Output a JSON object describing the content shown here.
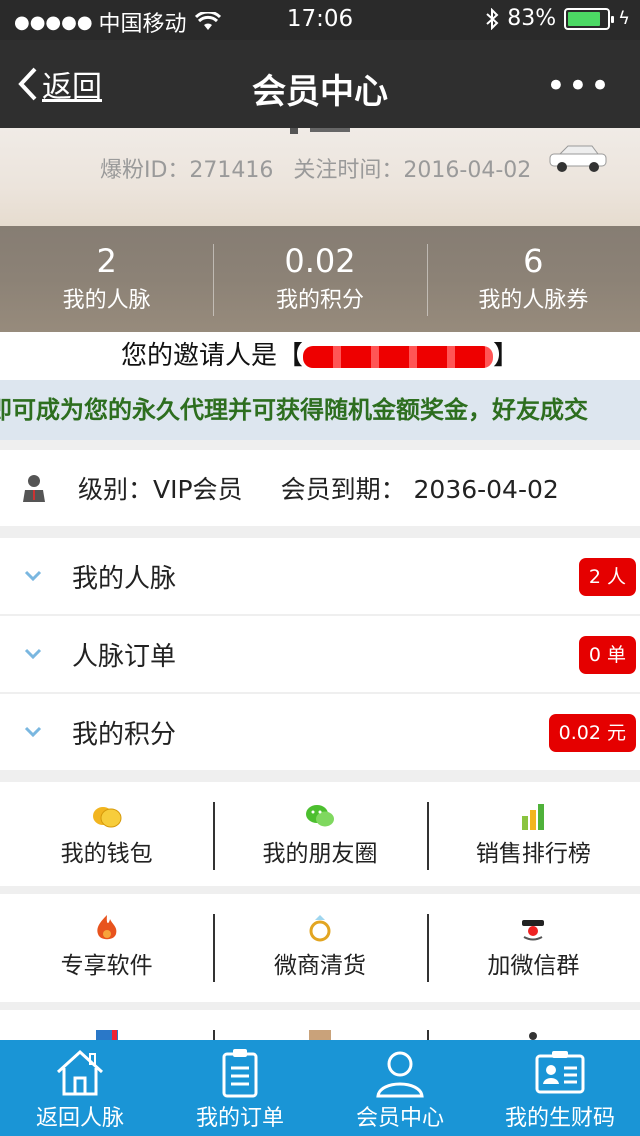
{
  "status_bar": {
    "carrier": "中国移动",
    "time": "17:06",
    "battery_percent": "83%",
    "battery_level": 0.83
  },
  "nav": {
    "back_label": "返回",
    "title": "会员中心",
    "more_label": "•••"
  },
  "profile": {
    "id_label": "爆粉ID：271416",
    "follow_label": "关注时间：2016-04-02"
  },
  "stats": [
    {
      "value": "2",
      "label": "我的人脉"
    },
    {
      "value": "0.02",
      "label": "我的积分"
    },
    {
      "value": "6",
      "label": "我的人脉券"
    }
  ],
  "inviter": {
    "prefix": "您的邀请人是【",
    "suffix": "】"
  },
  "marquee_text": "即可成为您的永久代理并可获得随机金额奖金，好友成交",
  "membership": {
    "level": "级别：VIP会员",
    "expiry": "会员到期：   2036-04-02"
  },
  "rows": [
    {
      "label": "我的人脉",
      "badge": "2 人"
    },
    {
      "label": "人脉订单",
      "badge": "0 单"
    },
    {
      "label": "我的积分",
      "badge": "0.02 元"
    }
  ],
  "grid_row1": [
    {
      "label": "我的钱包",
      "icon": "coins-icon"
    },
    {
      "label": "我的朋友圈",
      "icon": "wechat-icon"
    },
    {
      "label": "销售排行榜",
      "icon": "bar-chart-icon"
    }
  ],
  "grid_row2": [
    {
      "label": "专享软件",
      "icon": "flame-icon"
    },
    {
      "label": "微商清货",
      "icon": "ring-icon"
    },
    {
      "label": "加微信群",
      "icon": "clown-icon"
    }
  ],
  "tabs": [
    {
      "label": "返回人脉",
      "icon": "home-icon"
    },
    {
      "label": "我的订单",
      "icon": "clipboard-icon"
    },
    {
      "label": "会员中心",
      "icon": "person-icon"
    },
    {
      "label": "我的生财码",
      "icon": "id-card-icon"
    }
  ],
  "colors": {
    "tabbar": "#1a95d6",
    "badge": "#e50000",
    "marquee_text": "#2d6e1f"
  }
}
